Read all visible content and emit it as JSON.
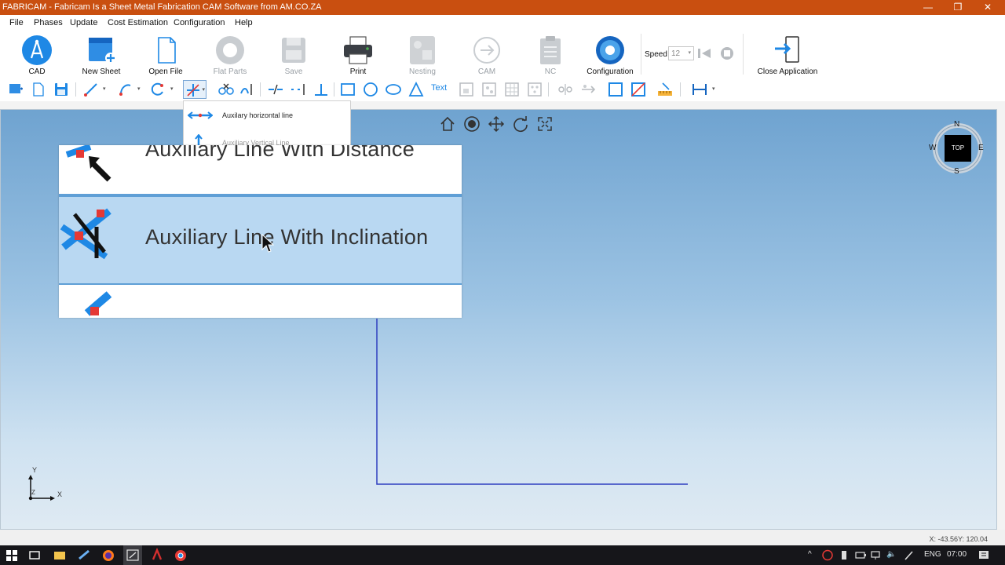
{
  "window": {
    "title": "FABRICAM - Fabricam Is a Sheet Metal Fabrication CAM Software from AM.CO.ZA",
    "minimize": "—",
    "restore": "❐",
    "close": "✕"
  },
  "menu": [
    "File",
    "Phases",
    "Update",
    "Cost Estimation",
    "Configuration",
    "Help"
  ],
  "ribbon": {
    "cad": "CAD",
    "new_sheet": "New Sheet",
    "open_file": "Open File",
    "flat_parts": "Flat Parts",
    "save": "Save",
    "print": "Print",
    "nesting": "Nesting",
    "cam": "CAM",
    "nc": "NC",
    "configuration": "Configuration",
    "speed_label": "Speed",
    "speed_value": "12",
    "close_application": "Close Application"
  },
  "toolbar2": {
    "text_tool": "Text"
  },
  "small_dropdown": {
    "items": [
      "Auxilary horizontal line",
      "Auxiliary Vertical Line"
    ]
  },
  "zoom_popup": {
    "items": [
      "Auxiliary Line With Distance",
      "Auxiliary Line With Inclination",
      ""
    ]
  },
  "compass": {
    "n": "N",
    "s": "S",
    "e": "E",
    "w": "W",
    "center": "TOP"
  },
  "axis": {
    "y": "Y",
    "x": "X",
    "z": "Z"
  },
  "status": {
    "coordinates": "X: -43.56Y: 120.04"
  },
  "taskbar": {
    "lang": "ENG",
    "time": "07:00"
  },
  "colors": {
    "titlebar": "#c94f10",
    "accent_blue": "#1e88e5",
    "selection": "#b9d8f2",
    "drawing_line": "#2f3fbf"
  }
}
